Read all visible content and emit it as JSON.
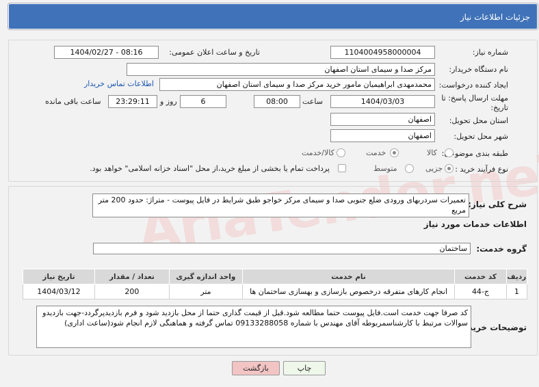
{
  "header": {
    "title": "جزئیات اطلاعات نیاز"
  },
  "form": {
    "need_number_label": "شماره نیاز:",
    "need_number": "1104004958000004",
    "announce_label": "تاریخ و ساعت اعلان عمومی:",
    "announce_value": "1404/02/27 - 08:16",
    "buyer_label": "نام دستگاه خریدار:",
    "buyer_value": "مرکز صدا و سیمای استان اصفهان",
    "creator_label": "ایجاد کننده درخواست:",
    "creator_value": "محمدمهدی ابراهیمیان مامور خرید مرکز صدا و سیمای استان اصفهان",
    "contact_link": "اطلاعات تماس خریدار",
    "deadline_label": "مهلت ارسال پاسخ: تا تاریخ:",
    "deadline_date": "1404/03/03",
    "time_label": "ساعت",
    "deadline_time": "08:00",
    "days_value": "6",
    "days_label": "روز و",
    "remaining_time": "23:29:11",
    "remaining_label": "ساعت باقی مانده",
    "province_label": "استان محل تحویل:",
    "province_value": "اصفهان",
    "city_label": "شهر محل تحویل:",
    "city_value": "اصفهان",
    "category_label": "طبقه بندی موضوعی:",
    "category_options": [
      "کالا",
      "خدمت",
      "کالا/خدمت"
    ],
    "category_selected": "خدمت",
    "process_label": "نوع فرآیند خرید :",
    "process_options": [
      "جزیی",
      "متوسط"
    ],
    "process_selected": "جزیی",
    "payment_note": "پرداخت تمام یا بخشی از مبلغ خرید،از محل \"اسناد خزانه اسلامی\" خواهد بود."
  },
  "summary": {
    "label": "شرح کلی نیاز:",
    "text": "تعمیرات سردربهای ورودی ضلع جنوبی صدا و سیمای مرکز خواجو طبق شرایط در فایل پیوست - متراژ: حدود 200 متر مربع"
  },
  "services": {
    "section_title": "اطلاعات خدمات مورد نیاز",
    "group_label": "گروه خدمت:",
    "group_value": "ساختمان",
    "table": {
      "headers": [
        "ردیف",
        "کد خدمت",
        "نام خدمت",
        "واحد اندازه گیری",
        "تعداد / مقدار",
        "تاریخ نیاز"
      ],
      "rows": [
        [
          "1",
          "ج-44",
          "انجام کارهای متفرقه درخصوص بازسازی و بهسازی ساختمان ها",
          "متر",
          "200",
          "1404/03/12"
        ]
      ]
    }
  },
  "notes": {
    "label": "توضیحات خریدار:",
    "text": "کد صرفا جهت خدمت است.فایل پیوست حتما مطالعه شود.قبل از قیمت گذاری حتما از محل بازدید شود و فرم بازدیدپرگردد-جهت بازدیدو سوالات مرتبط با کارشناسمربوطه آقای مهندس با شماره 09133288058 تماس گرفته و هماهنگی لازم انجام شود(ساعت اداری)"
  },
  "buttons": {
    "print": "چاپ",
    "back": "بازگشت"
  },
  "watermark": "AriaTender.neT",
  "colors": {
    "header": "#3f72b8",
    "link": "#1a56b5",
    "back_button": "#f2c4c4",
    "print_button": "#eef7ea"
  }
}
